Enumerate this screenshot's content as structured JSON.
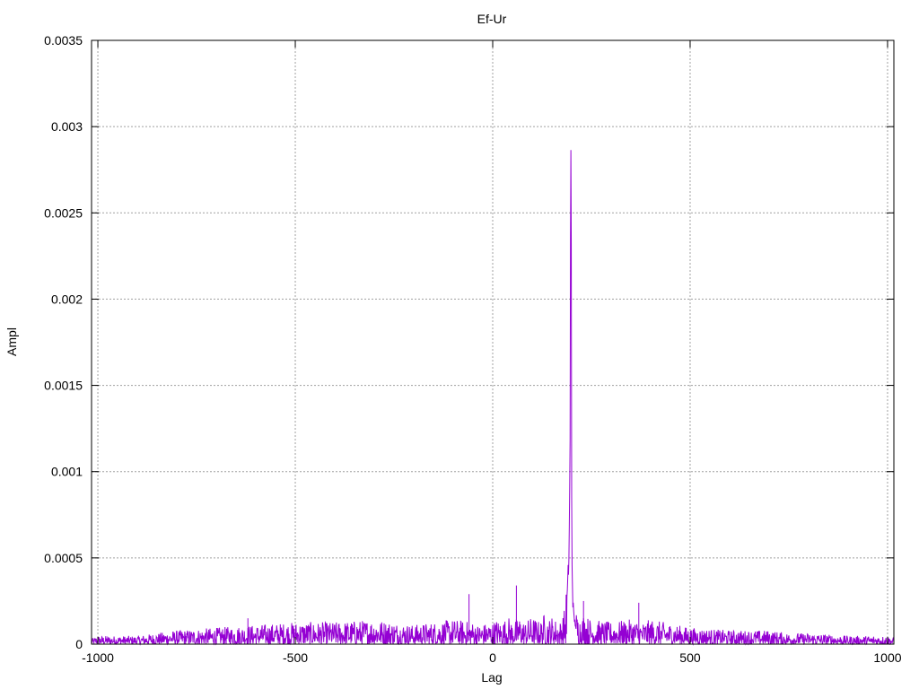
{
  "chart_data": {
    "type": "line",
    "title": "Ef-Ur",
    "xlabel": "Lag",
    "ylabel": "Ampl",
    "xlim": [
      -1016,
      1016
    ],
    "ylim": [
      0,
      0.0035
    ],
    "x_ticks": [
      -1000,
      -500,
      0,
      500,
      1000
    ],
    "x_tick_labels": [
      "-1000",
      "-500",
      "0",
      "500",
      "1000"
    ],
    "y_ticks": [
      0,
      0.0005,
      0.001,
      0.0015,
      0.002,
      0.0025,
      0.003,
      0.0035
    ],
    "y_tick_labels": [
      "0",
      "0.0005",
      "0.001",
      "0.0015",
      "0.002",
      "0.0025",
      "0.003",
      "0.0035"
    ],
    "grid": true,
    "series": [
      {
        "color": "#9400d3",
        "x": [
          -1016,
          -1000,
          -900,
          -800,
          -700,
          -600,
          -500,
          -400,
          -300,
          -250,
          -200,
          -150,
          -100,
          -50,
          -40,
          0,
          10,
          20,
          30,
          40,
          50,
          60,
          70,
          80,
          90,
          100,
          110,
          120,
          130,
          140,
          150,
          160,
          170,
          175,
          180,
          185,
          190,
          193,
          195,
          196,
          197,
          198,
          199,
          200,
          201,
          202,
          203,
          205,
          208,
          212,
          220,
          230,
          250,
          300,
          350,
          380,
          400,
          500,
          600,
          700,
          750,
          800,
          900,
          1000,
          1016
        ],
        "y": [
          2e-05,
          3e-05,
          3e-05,
          5e-05,
          6e-05,
          7e-05,
          8e-05,
          8e-05,
          9e-05,
          8e-05,
          7e-05,
          8e-05,
          9e-05,
          8e-05,
          7e-05,
          8e-05,
          9e-05,
          8e-05,
          9e-05,
          0.0001,
          8e-05,
          9e-05,
          0.0001,
          8e-05,
          9e-05,
          0.0001,
          9e-05,
          8e-05,
          0.00011,
          9e-05,
          0.0001,
          9e-05,
          8e-05,
          0.0001,
          0.00012,
          0.00015,
          0.0004,
          0.0006,
          0.001,
          0.0015,
          0.00252,
          0.00323,
          0.0025,
          0.001,
          0.0006,
          0.0004,
          0.0003,
          0.0002,
          0.00015,
          0.00012,
          0.0001,
          0.00011,
          9e-05,
          8e-05,
          9e-05,
          8e-05,
          9e-05,
          6e-05,
          5e-05,
          5e-05,
          4e-05,
          4e-05,
          3e-05,
          3e-05,
          2e-05
        ]
      }
    ],
    "spike_annotations": [
      {
        "x": -60,
        "y": 0.00029
      },
      {
        "x": 60,
        "y": 0.00034
      },
      {
        "x": 230,
        "y": 0.00025
      },
      {
        "x": 370,
        "y": 0.00024
      },
      {
        "x": -620,
        "y": 0.00015
      }
    ]
  }
}
